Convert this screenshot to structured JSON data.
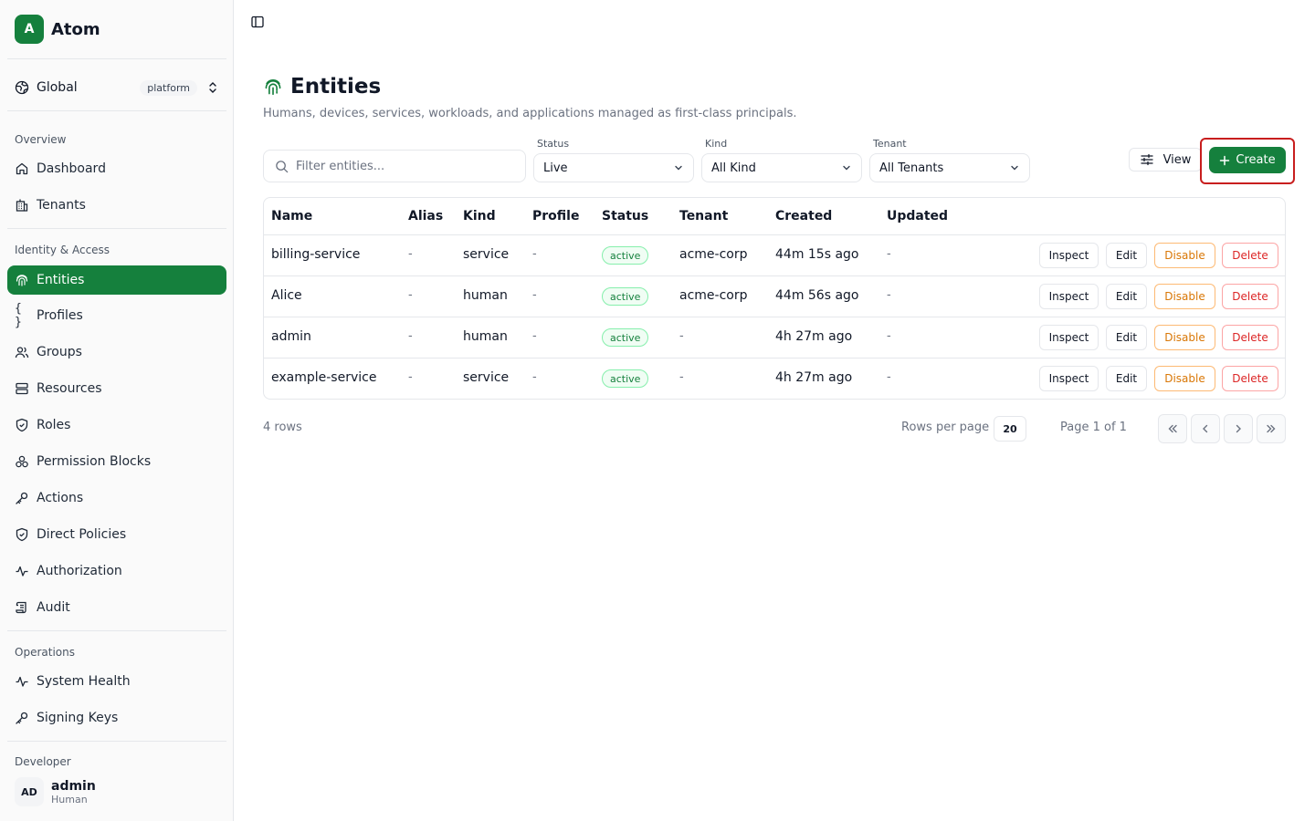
{
  "brand": {
    "logo_letter": "A",
    "name": "Atom"
  },
  "scope": {
    "label": "Global",
    "badge": "platform"
  },
  "sidebar": {
    "sections": [
      {
        "label": "Overview",
        "items": [
          {
            "label": "Dashboard",
            "icon": "home-icon"
          },
          {
            "label": "Tenants",
            "icon": "building-icon"
          }
        ]
      },
      {
        "label": "Identity & Access",
        "items": [
          {
            "label": "Entities",
            "icon": "fingerprint-icon",
            "active": true
          },
          {
            "label": "Profiles",
            "icon": "braces-icon"
          },
          {
            "label": "Groups",
            "icon": "users-icon"
          },
          {
            "label": "Resources",
            "icon": "server-icon"
          },
          {
            "label": "Roles",
            "icon": "shield-icon"
          },
          {
            "label": "Permission Blocks",
            "icon": "blocks-icon"
          },
          {
            "label": "Actions",
            "icon": "key-icon"
          },
          {
            "label": "Direct Policies",
            "icon": "shield-check-icon"
          },
          {
            "label": "Authorization",
            "icon": "activity-icon"
          },
          {
            "label": "Audit",
            "icon": "scroll-icon"
          }
        ]
      },
      {
        "label": "Operations",
        "items": [
          {
            "label": "System Health",
            "icon": "activity-icon"
          },
          {
            "label": "Signing Keys",
            "icon": "key-icon"
          }
        ]
      }
    ],
    "truncated_section": "Developer"
  },
  "user": {
    "initials": "AD",
    "name": "admin",
    "kind": "Human"
  },
  "page": {
    "title": "Entities",
    "subtitle": "Humans, devices, services, workloads, and applications managed as first-class principals."
  },
  "filters": {
    "search_placeholder": "Filter entities...",
    "status": {
      "label": "Status",
      "value": "Live"
    },
    "kind": {
      "label": "Kind",
      "value": "All Kind"
    },
    "tenant": {
      "label": "Tenant",
      "value": "All Tenants"
    },
    "view_label": "View",
    "create_label": "Create"
  },
  "table": {
    "columns": [
      "Name",
      "Alias",
      "Kind",
      "Profile",
      "Status",
      "Tenant",
      "Created",
      "Updated"
    ],
    "rows": [
      {
        "name": "billing-service",
        "alias": "-",
        "kind": "service",
        "profile": "-",
        "status": "active",
        "tenant": "acme-corp",
        "created": "44m 15s ago",
        "updated": "-"
      },
      {
        "name": "Alice",
        "alias": "-",
        "kind": "human",
        "profile": "-",
        "status": "active",
        "tenant": "acme-corp",
        "created": "44m 56s ago",
        "updated": "-"
      },
      {
        "name": "admin",
        "alias": "-",
        "kind": "human",
        "profile": "-",
        "status": "active",
        "tenant": "-",
        "created": "4h 27m ago",
        "updated": "-"
      },
      {
        "name": "example-service",
        "alias": "-",
        "kind": "service",
        "profile": "-",
        "status": "active",
        "tenant": "-",
        "created": "4h 27m ago",
        "updated": "-"
      }
    ],
    "actions": {
      "inspect": "Inspect",
      "edit": "Edit",
      "disable": "Disable",
      "delete": "Delete"
    }
  },
  "pagination": {
    "row_count": "4 rows",
    "rows_per_page_label": "Rows per page",
    "rows_per_page": "20",
    "page_info": "Page 1 of 1"
  },
  "colors": {
    "accent": "#15803d",
    "danger": "#dc2626",
    "warning": "#d97706",
    "highlight": "#c81e1e"
  }
}
